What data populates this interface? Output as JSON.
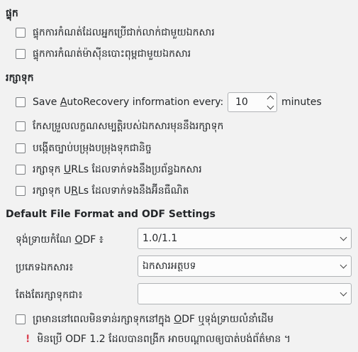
{
  "section_merge": {
    "title": "ផ្ទុក",
    "options": [
      {
        "label": "ផ្ទុកការកំណត់ដែលអ្នកប្រើជាក់លាក់ជាមួយឯកសារ",
        "checked": false
      },
      {
        "label": "ផ្ទុកការកំណត់ម៉ាស៊ីនបោះពុម្ពជាមួយឯកសារ",
        "checked": false
      }
    ]
  },
  "section_save": {
    "title": "រក្សាទុក",
    "autorecovery": {
      "label_before": "Save ",
      "label_mnemonic": "A",
      "label_after": "utoRecovery information every:",
      "value": "10",
      "unit": "minutes",
      "checked": false
    },
    "options": [
      {
        "label": "កែសម្រួលលក្ខណសម្បត្តិរបស់ឯកសារមុននឹងរក្សាទុក",
        "checked": false
      },
      {
        "label": "បង្កើតច្បាប់បម្រុងបម្រុងទុកជានិច្ច",
        "checked": false
      }
    ],
    "urls_fs": {
      "pre": "រក្សាទុក ",
      "mn": "U",
      "post": "RLs ដែលទាក់ទងនឹងប្រព័ន្ធឯកសារ",
      "checked": false
    },
    "urls_net": {
      "pre": "រក្សាទុក U",
      "mn": "R",
      "post": "Ls ដែលទាក់ទងនឹងអ៊ីនធឺណិត",
      "checked": false
    }
  },
  "section_format": {
    "title": "Default File Format and ODF Settings",
    "odf_version": {
      "label_pre": "ទុង់ទ្រាយកំណែ ",
      "label_mn": "O",
      "label_post": "DF ៖",
      "value": "1.0/1.1"
    },
    "doc_type": {
      "label": "ប្រភេទឯកសារ៖",
      "value": "ឯកសារអត្ថបទ"
    },
    "always_save_as": {
      "label": "តែងតែរក្សាទុកជា៖",
      "value": ""
    },
    "warn_option": {
      "pre": "ព្រមាននៅពេលមិនទាន់រក្សាទុកនៅក្នុង ",
      "mn": "O",
      "post": "DF ឬទុង់ទ្រាយលំនាំដើម",
      "checked": false
    },
    "warning_icon": "exclamation-icon",
    "warning_color": "#da4453",
    "warning_text": "មិនប្រើ ODF 1.2 ដែលបានពង្រីក អាចបណ្ដាលឲ្យបាត់បង់ព័ត៌មាន ។"
  }
}
